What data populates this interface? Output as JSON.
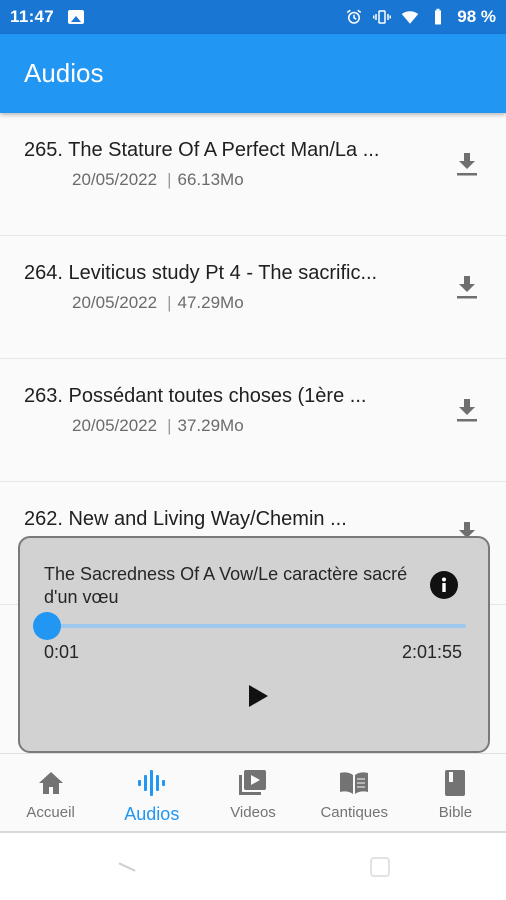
{
  "status_bar": {
    "time": "11:47",
    "battery": "98 %"
  },
  "app_bar": {
    "title": "Audios"
  },
  "audios": [
    {
      "title": "265. The Stature Of A Perfect Man/La ...",
      "date": "20/05/2022",
      "sep": "|",
      "size": "66.13Mo"
    },
    {
      "title": "264. Leviticus study  Pt 4 - The sacrific...",
      "date": "20/05/2022",
      "sep": "|",
      "size": "47.29Mo"
    },
    {
      "title": "263. Possédant toutes choses (1ère ...",
      "date": "20/05/2022",
      "sep": "|",
      "size": "37.29Mo"
    },
    {
      "title": "262. New and Living Way/Chemin ...",
      "date": "",
      "sep": "",
      "size": ""
    }
  ],
  "player": {
    "title": "The Sacredness Of A Vow/Le caractère sacré d'un vœu",
    "current_time": "0:01",
    "total_time": "2:01:55",
    "progress": 0.0001
  },
  "bottom_nav": [
    {
      "label": "Accueil",
      "icon": "home-icon",
      "active": false
    },
    {
      "label": "Audios",
      "icon": "audio-wave-icon",
      "active": true
    },
    {
      "label": "Videos",
      "icon": "video-library-icon",
      "active": false
    },
    {
      "label": "Cantiques",
      "icon": "open-book-icon",
      "active": false
    },
    {
      "label": "Bible",
      "icon": "bible-book-icon",
      "active": false
    }
  ],
  "colors": {
    "primary": "#2196f3",
    "status_bar": "#1976d2",
    "nav_inactive": "#737373"
  }
}
